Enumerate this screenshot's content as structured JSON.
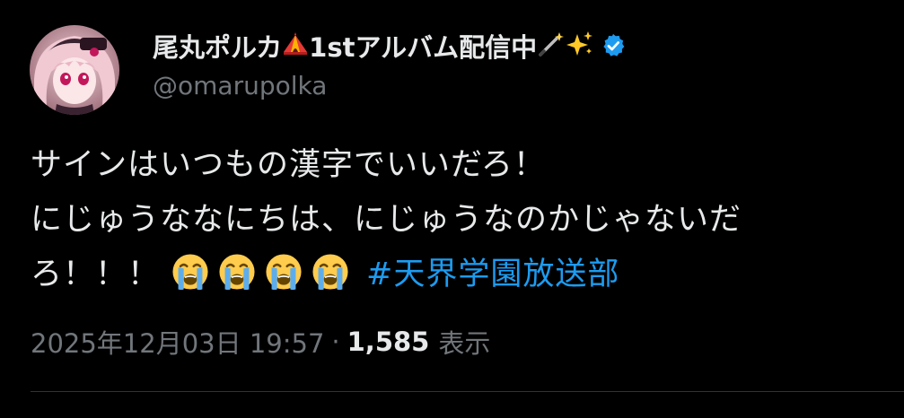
{
  "author": {
    "display_name": "尾丸ポルカ",
    "display_name_suffix": "1stアルバム配信中",
    "handle": "@omarupolka",
    "verified": true,
    "emojis": [
      "circus-tent",
      "magic-wand",
      "sparkles"
    ]
  },
  "tweet": {
    "line1": "サインはいつもの漢字でいいだろ！",
    "line2": "にじゅうななにちは、にじゅうなのかじゃないだ",
    "line3": "ろ！！！",
    "crying_emoji_count": 4,
    "hashtag": "#天界学園放送部"
  },
  "meta": {
    "timestamp": "2025年12月03日 19:57",
    "separator": "·",
    "views_count": "1,585",
    "views_label": "表示"
  },
  "colors": {
    "background": "#000000",
    "text": "#e7e9ea",
    "muted": "#71767b",
    "link": "#1d9bf0",
    "divider": "#2f3336"
  }
}
